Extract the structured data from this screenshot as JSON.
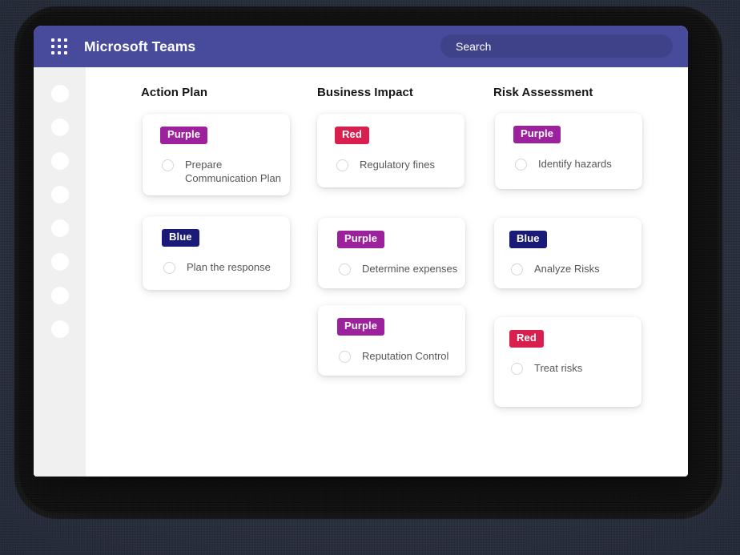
{
  "window": {
    "titlebar": {
      "app_title": "Microsoft Teams",
      "waffle_icon": "grid-apps-icon",
      "search": {
        "placeholder": "Search",
        "value": "",
        "icon": "search-icon"
      },
      "background_color": "#484b9c"
    },
    "sidebar": {
      "background_color": "#f0f0f0",
      "items": [
        {
          "icon": "circle-placeholder-icon"
        },
        {
          "icon": "circle-placeholder-icon"
        },
        {
          "icon": "circle-placeholder-icon"
        },
        {
          "icon": "circle-placeholder-icon"
        },
        {
          "icon": "circle-placeholder-icon"
        },
        {
          "icon": "circle-placeholder-icon"
        },
        {
          "icon": "circle-placeholder-icon"
        },
        {
          "icon": "circle-placeholder-icon"
        }
      ]
    }
  },
  "board": {
    "tag_colors": {
      "Purple": "#9c219c",
      "Blue": "#1a1a78",
      "Red": "#d91f4e"
    },
    "columns": [
      {
        "title": "Action Plan",
        "cards": [
          {
            "tag": "Purple",
            "tag_class": "tag-purple",
            "task": "Prepare Communication Plan"
          },
          {
            "tag": "Blue",
            "tag_class": "tag-blue",
            "task": "Plan the response"
          }
        ]
      },
      {
        "title": "Business Impact",
        "cards": [
          {
            "tag": "Red",
            "tag_class": "tag-red",
            "task": "Regulatory fines"
          },
          {
            "tag": "Purple",
            "tag_class": "tag-purple",
            "task": "Determine expenses"
          },
          {
            "tag": "Purple",
            "tag_class": "tag-purple",
            "task": "Reputation Control"
          }
        ]
      },
      {
        "title": "Risk Assessment",
        "cards": [
          {
            "tag": "Purple",
            "tag_class": "tag-purple",
            "task": "Identify hazards"
          },
          {
            "tag": "Blue",
            "tag_class": "tag-blue",
            "task": "Analyze Risks"
          },
          {
            "tag": "Red",
            "tag_class": "tag-red",
            "task": "Treat risks"
          }
        ]
      }
    ]
  }
}
